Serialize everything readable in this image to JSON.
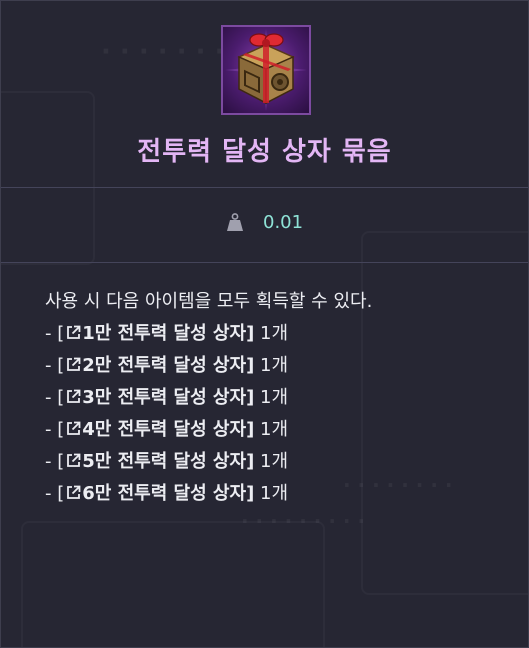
{
  "item": {
    "name": "전투력 달성 상자 묶음",
    "icon": "treasure-box-icon",
    "name_color": "#e3b6f5"
  },
  "weight": {
    "icon": "weight-icon",
    "value": "0.01",
    "value_color": "#8ee2d6"
  },
  "description": {
    "intro": "사용 시 다음 아이템을 모두 획득할 수 있다.",
    "entries": [
      {
        "prefix": "- [",
        "name": "1만 전투력 달성 상자",
        "suffix": "]",
        "qty": " 1개"
      },
      {
        "prefix": "- [",
        "name": "2만 전투력 달성 상자",
        "suffix": "]",
        "qty": " 1개"
      },
      {
        "prefix": "- [",
        "name": "3만 전투력 달성 상자",
        "suffix": "]",
        "qty": " 1개"
      },
      {
        "prefix": "- [",
        "name": "4만 전투력 달성 상자",
        "suffix": "]",
        "qty": " 1개"
      },
      {
        "prefix": "- [",
        "name": "5만 전투력 달성 상자",
        "suffix": "]",
        "qty": " 1개"
      },
      {
        "prefix": "- [",
        "name": "6만 전투력 달성 상자",
        "suffix": "]",
        "qty": " 1개"
      }
    ]
  },
  "colors": {
    "panel_bg": "#262633",
    "divider": "#44445a",
    "text": "#ecedf2"
  }
}
